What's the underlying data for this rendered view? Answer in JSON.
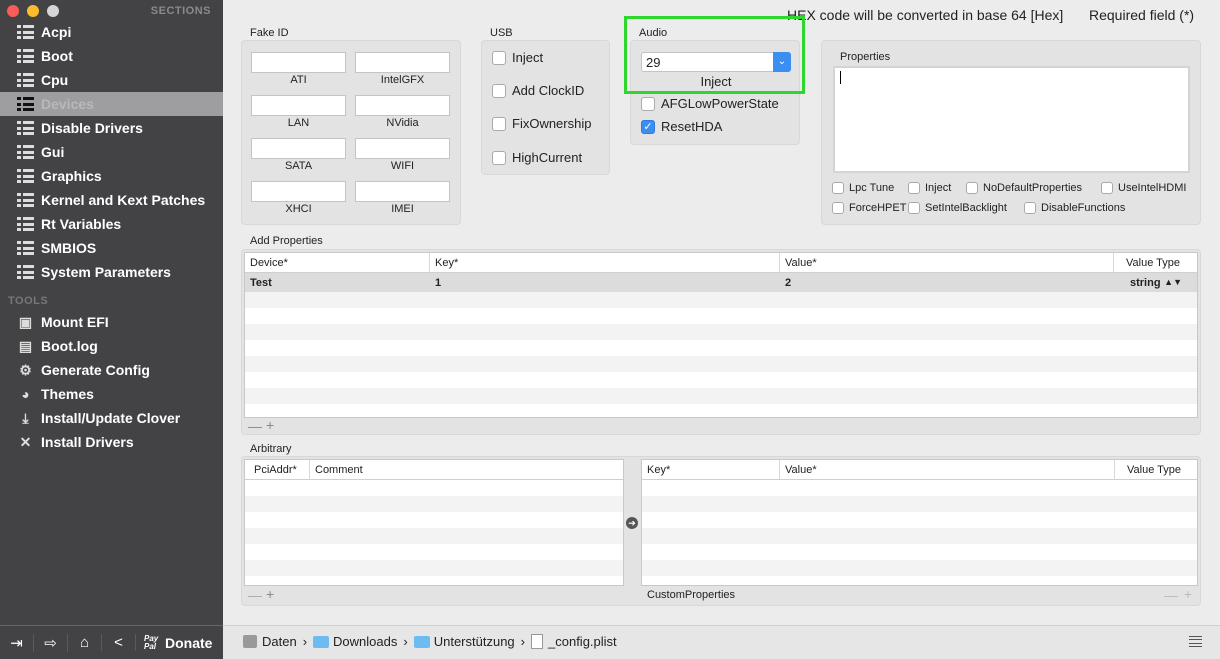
{
  "sidebar": {
    "sections_label": "SECTIONS",
    "items": [
      {
        "label": "Acpi"
      },
      {
        "label": "Boot"
      },
      {
        "label": "Cpu"
      },
      {
        "label": "Devices",
        "selected": true
      },
      {
        "label": "Disable Drivers"
      },
      {
        "label": "Gui"
      },
      {
        "label": "Graphics"
      },
      {
        "label": "Kernel and Kext Patches"
      },
      {
        "label": "Rt Variables"
      },
      {
        "label": "SMBIOS"
      },
      {
        "label": "System Parameters"
      }
    ],
    "tools_label": "TOOLS",
    "tools": [
      {
        "label": "Mount EFI",
        "icon": "disk-icon"
      },
      {
        "label": "Boot.log",
        "icon": "document-icon"
      },
      {
        "label": "Generate Config",
        "icon": "gear-icon"
      },
      {
        "label": "Themes",
        "icon": "palette-icon"
      },
      {
        "label": "Install/Update Clover",
        "icon": "download-icon"
      },
      {
        "label": "Install Drivers",
        "icon": "tools-icon"
      }
    ]
  },
  "header": {
    "hex_note": "HEX code will be converted in base 64 [Hex]",
    "required_note": "Required field (*)"
  },
  "fake_id": {
    "label": "Fake ID",
    "fields": [
      {
        "label": "ATI",
        "value": ""
      },
      {
        "label": "IntelGFX",
        "value": ""
      },
      {
        "label": "LAN",
        "value": ""
      },
      {
        "label": "NVidia",
        "value": ""
      },
      {
        "label": "SATA",
        "value": ""
      },
      {
        "label": "WIFI",
        "value": ""
      },
      {
        "label": "XHCI",
        "value": ""
      },
      {
        "label": "IMEI",
        "value": ""
      }
    ]
  },
  "usb": {
    "label": "USB",
    "options": [
      {
        "label": "Inject",
        "checked": false
      },
      {
        "label": "Add ClockID",
        "checked": false
      },
      {
        "label": "FixOwnership",
        "checked": false
      },
      {
        "label": "HighCurrent",
        "checked": false
      }
    ]
  },
  "audio": {
    "label": "Audio",
    "inject_value": "29",
    "inject_label": "Inject",
    "options": [
      {
        "label": "AFGLowPowerState",
        "checked": false
      },
      {
        "label": "ResetHDA",
        "checked": true
      }
    ],
    "highlight_color": "#2ed62e"
  },
  "properties": {
    "label": "Properties",
    "value": "",
    "row1": [
      {
        "label": "Lpc Tune"
      },
      {
        "label": "Inject"
      },
      {
        "label": "NoDefaultProperties"
      },
      {
        "label": "UseIntelHDMI"
      }
    ],
    "row2": [
      {
        "label": "ForceHPET"
      },
      {
        "label": "SetIntelBacklight"
      },
      {
        "label": "DisableFunctions"
      }
    ]
  },
  "add_properties": {
    "label": "Add Properties",
    "columns": [
      "Device*",
      "Key*",
      "Value*",
      "Value Type"
    ],
    "rows": [
      {
        "device": "Test",
        "key": "1",
        "value": "2",
        "type": "string"
      }
    ]
  },
  "arbitrary": {
    "label": "Arbitrary",
    "left_columns": [
      "PciAddr*",
      "Comment"
    ],
    "right_columns": [
      "Key*",
      "Value*",
      "Value Type"
    ],
    "custom_label": "CustomProperties"
  },
  "controls": {
    "minus": "—",
    "plus": "+"
  },
  "bottom": {
    "donate": "Donate",
    "paypal": "Pay Pal",
    "path": [
      "Daten",
      "Downloads",
      "Unterstützung",
      "_config.plist"
    ],
    "sep": "›"
  }
}
